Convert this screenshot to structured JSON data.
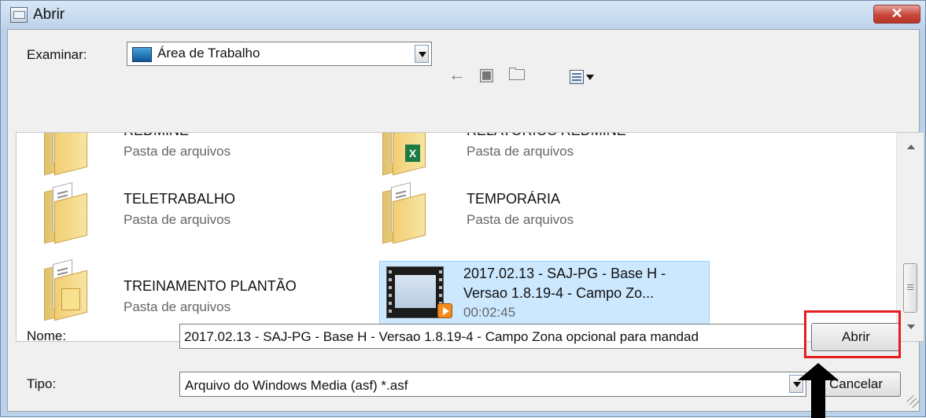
{
  "window": {
    "title": "Abrir",
    "close_symbol": "✕",
    "icon": "dialog-icon"
  },
  "toolbar": {
    "look_in_label": "Examinar:",
    "look_in_value": "Área de Trabalho",
    "back_icon": "back-arrow-icon",
    "up_folder_icon": "up-folder-icon",
    "new_folder_icon": "new-folder-icon",
    "view_menu_icon": "view-menu-icon"
  },
  "files": [
    {
      "name": "REDMINE",
      "type": "Pasta de arquivos",
      "icon": "folder-icon"
    },
    {
      "name": "RELATÓRIOS REDMINE",
      "type": "Pasta de arquivos",
      "icon": "folder-excel-icon",
      "badge": "X"
    },
    {
      "name": "TELETRABALHO",
      "type": "Pasta de arquivos",
      "icon": "folder-icon"
    },
    {
      "name": "TEMPORÁRIA",
      "type": "Pasta de arquivos",
      "icon": "folder-icon"
    },
    {
      "name": "TREINAMENTO PLANTÃO",
      "type": "Pasta de arquivos",
      "icon": "folder-envelope-icon"
    },
    {
      "name_line1": "2017.02.13 - SAJ-PG - Base H -",
      "name_line2": "Versao 1.8.19-4 - Campo Zo...",
      "duration": "00:02:45",
      "icon": "video-file-icon",
      "selected": true
    }
  ],
  "footer": {
    "name_label": "Nome:",
    "name_value": "2017.02.13 - SAJ-PG - Base H - Versao 1.8.19-4 - Campo Zona opcional para mandad",
    "type_label": "Tipo:",
    "type_value": "Arquivo do Windows Media (asf) *.asf",
    "open_button": "Abrir",
    "cancel_button": "Cancelar"
  },
  "annotations": {
    "highlight_color": "#e51d21",
    "arrow_color": "#000000"
  }
}
